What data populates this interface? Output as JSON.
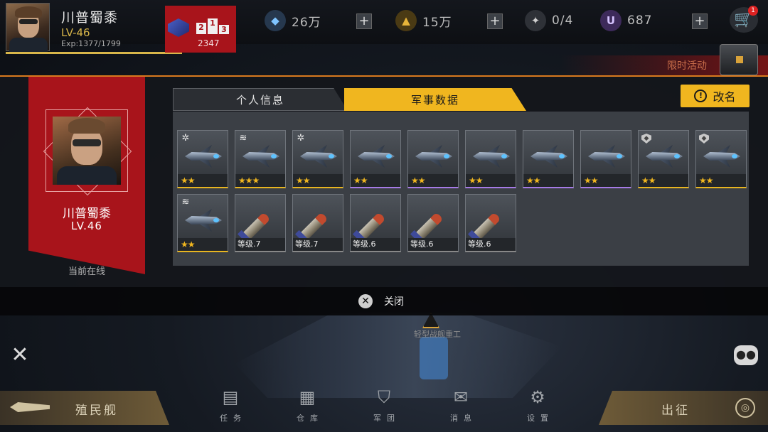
{
  "player": {
    "name": "川普蜀黍",
    "level": "LV-46",
    "exp": "Exp:1377/1799",
    "rank_score": "2347",
    "podium": [
      "2",
      "1",
      "3"
    ]
  },
  "resources": {
    "crystal": "26万",
    "gold": "15万",
    "fleet": "0/4",
    "u_coin": "687"
  },
  "cart_badge": "1",
  "event": {
    "label": "限时活动"
  },
  "profile_panel": {
    "name": "川普蜀黍",
    "level": "LV.46",
    "status": "当前在线",
    "tabs": [
      "个人信息",
      "军事数据"
    ],
    "active_tab": "军事数据",
    "rename_label": "改名"
  },
  "military_items": [
    {
      "kind": "ship",
      "stars": "★★",
      "quality": "gold",
      "badge": "gear"
    },
    {
      "kind": "ship",
      "stars": "★★★",
      "quality": "gold",
      "badge": "wings"
    },
    {
      "kind": "ship",
      "stars": "★★",
      "quality": "gold",
      "badge": "gear"
    },
    {
      "kind": "ship",
      "stars": "★★",
      "quality": "purple",
      "badge": ""
    },
    {
      "kind": "ship",
      "stars": "★★",
      "quality": "purple",
      "badge": ""
    },
    {
      "kind": "ship",
      "stars": "★★",
      "quality": "purple",
      "badge": ""
    },
    {
      "kind": "ship",
      "stars": "★★",
      "quality": "purple",
      "badge": ""
    },
    {
      "kind": "ship",
      "stars": "★★",
      "quality": "purple",
      "badge": ""
    },
    {
      "kind": "ship",
      "stars": "★★",
      "quality": "gold",
      "badge": "shield"
    },
    {
      "kind": "ship",
      "stars": "★★",
      "quality": "gold",
      "badge": "shield"
    },
    {
      "kind": "ship",
      "stars": "★★",
      "quality": "gold",
      "badge": "wings"
    },
    {
      "kind": "missile",
      "level": "等级.7",
      "quality": "white"
    },
    {
      "kind": "missile",
      "level": "等级.7",
      "quality": "white"
    },
    {
      "kind": "missile",
      "level": "等级.6",
      "quality": "white"
    },
    {
      "kind": "missile",
      "level": "等级.6",
      "quality": "white"
    },
    {
      "kind": "missile",
      "level": "等级.6",
      "quality": "white"
    }
  ],
  "close_label": "关闭",
  "map_label": "轻型战舰重工",
  "bottom": {
    "colony_ship": "殖民舰",
    "deploy": "出征",
    "nav": [
      {
        "label": "任务",
        "icon": "task-icon"
      },
      {
        "label": "仓库",
        "icon": "warehouse-icon"
      },
      {
        "label": "军团",
        "icon": "legion-icon"
      },
      {
        "label": "消息",
        "icon": "mail-icon"
      },
      {
        "label": "设置",
        "icon": "settings-icon"
      }
    ]
  },
  "colors": {
    "accent": "#f0b61f",
    "banner_red": "#a8141b",
    "panel_border": "#d97a1e"
  }
}
